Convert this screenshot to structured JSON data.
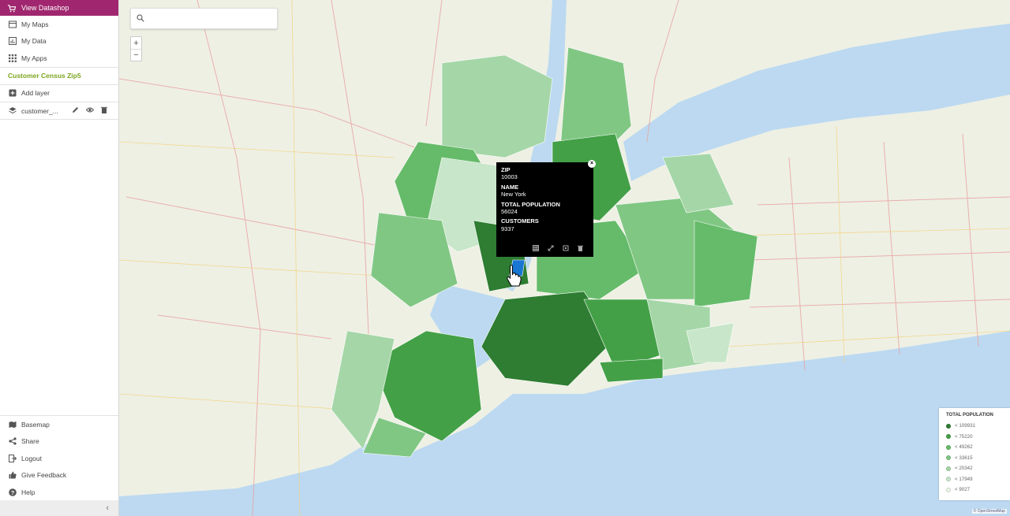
{
  "sidebar": {
    "datashop_label": "View Datashop",
    "nav": [
      {
        "label": "My Maps",
        "icon": "map-icon"
      },
      {
        "label": "My Data",
        "icon": "bar-chart-icon"
      },
      {
        "label": "My Apps",
        "icon": "apps-grid-icon"
      }
    ],
    "map_title": "Customer Census Zip5",
    "add_layer_label": "Add layer",
    "layer_name": "customer_...",
    "bottom": [
      {
        "label": "Basemap",
        "icon": "basemap-icon"
      },
      {
        "label": "Share",
        "icon": "share-icon"
      },
      {
        "label": "Logout",
        "icon": "logout-icon"
      },
      {
        "label": "Give Feedback",
        "icon": "thumbs-up-icon"
      },
      {
        "label": "Help",
        "icon": "help-icon"
      }
    ],
    "collapse_label": "‹"
  },
  "search": {
    "placeholder": "",
    "value": ""
  },
  "zoom": {
    "in": "+",
    "out": "−"
  },
  "popup": {
    "fields": [
      {
        "label": "ZIP",
        "value": "10003"
      },
      {
        "label": "NAME",
        "value": "New York"
      },
      {
        "label": "TOTAL POPULATION",
        "value": "56024"
      },
      {
        "label": "CUSTOMERS",
        "value": "9337"
      }
    ],
    "close": "×"
  },
  "legend": {
    "title": "TOTAL POPULATION",
    "items": [
      {
        "label": "< 109931",
        "color": "#2e7d32"
      },
      {
        "label": "< 75220",
        "color": "#43a047"
      },
      {
        "label": "< 49262",
        "color": "#66bb6a"
      },
      {
        "label": "< 33615",
        "color": "#81c784"
      },
      {
        "label": "< 20342",
        "color": "#a5d6a7"
      },
      {
        "label": "< 17949",
        "color": "#c8e6c9"
      },
      {
        "label": "< 9027",
        "color": "#edf7e8"
      }
    ]
  },
  "attribution": "© OpenStreetMap",
  "colors": {
    "brand": "#a0276f",
    "accent": "#7ba51e",
    "water": "#bcd9f1",
    "land": "#eef0e4"
  }
}
